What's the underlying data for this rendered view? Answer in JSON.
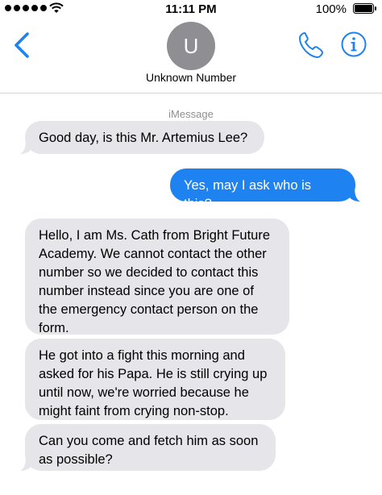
{
  "status_bar": {
    "time": "11:11 PM",
    "battery_percent": "100%",
    "signal_bars": 5,
    "icons": [
      "signal-dots-icon",
      "wifi-icon",
      "battery-icon"
    ]
  },
  "header": {
    "avatar_initial": "U",
    "contact_name": "Unknown Number",
    "icons": [
      "chevron-left-icon",
      "phone-icon",
      "info-icon"
    ],
    "accent_color": "#1e82f0"
  },
  "conversation": {
    "service_label": "iMessage",
    "messages": [
      {
        "direction": "incoming",
        "text": "Good day, is this Mr. Artemius Lee?"
      },
      {
        "direction": "outgoing",
        "text": "Yes, may I ask who is this?"
      },
      {
        "direction": "incoming",
        "text": "Hello, I am Ms. Cath from Bright Future Academy. We cannot contact the other number so we decided to contact this number instead since you are one of the emergency contact person on the form."
      },
      {
        "direction": "incoming",
        "text": "He got into a fight this morning and asked for his Papa. He is still crying up until now, we're worried because he might faint from crying non-stop."
      },
      {
        "direction": "incoming",
        "text": "Can you come and fetch him as soon as possible?"
      }
    ],
    "colors": {
      "incoming_bubble": "#e5e5ea",
      "outgoing_bubble": "#1e82f0"
    }
  }
}
